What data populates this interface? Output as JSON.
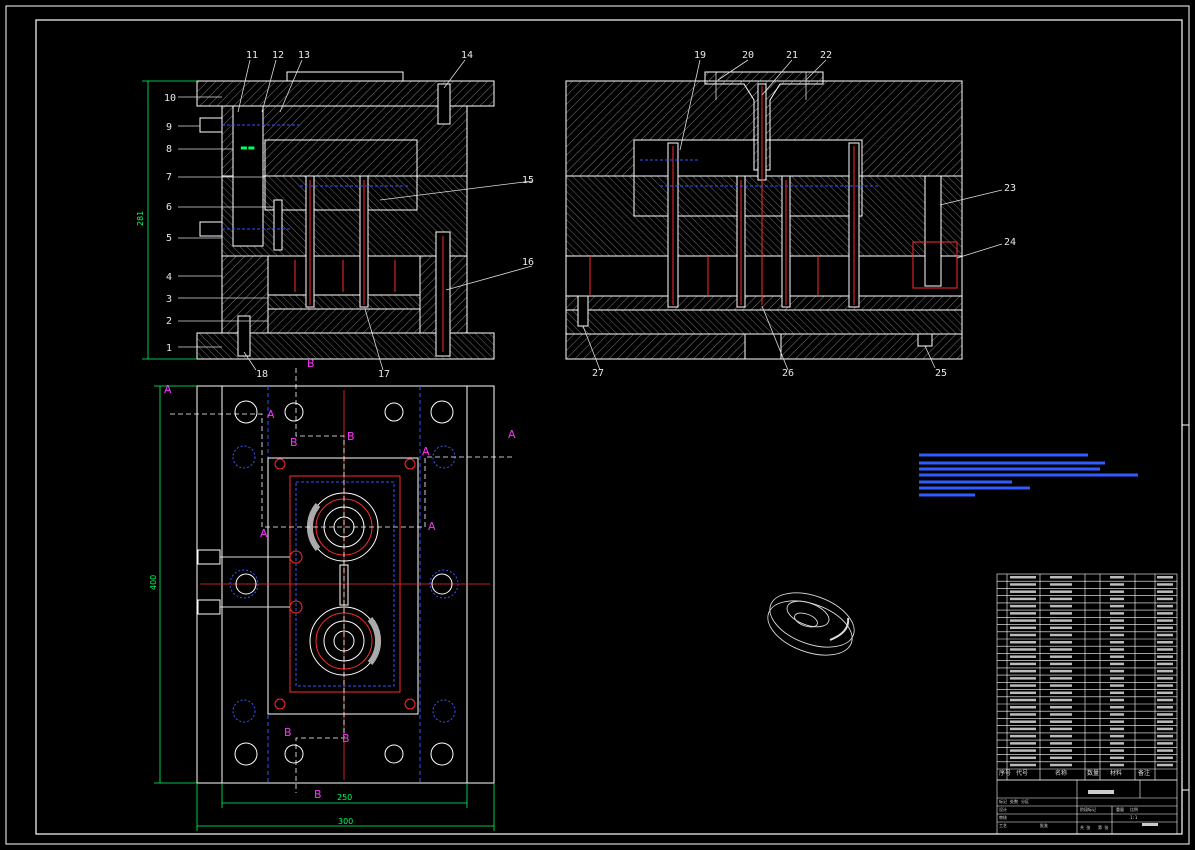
{
  "part_callouts": [
    "1",
    "2",
    "3",
    "4",
    "5",
    "6",
    "7",
    "8",
    "9",
    "10",
    "11",
    "12",
    "13",
    "14",
    "15",
    "16",
    "17",
    "18",
    "19",
    "20",
    "21",
    "22",
    "23",
    "24",
    "25",
    "26",
    "27"
  ],
  "section_marks": {
    "a": "A",
    "b": "B"
  },
  "dimensions": {
    "height_front": "281",
    "height_plan": "400",
    "width_inner": "250",
    "width_outer": "300"
  },
  "colors": {
    "background": "#000000",
    "outline": "#ffffff",
    "hatch": "#bbbbbb",
    "hidden_blue": "#3355ff",
    "center_red": "#ff2a2a",
    "dimension_green": "#00ff66",
    "section_magenta": "#ff33ff"
  },
  "bom": {
    "header": [
      "序号",
      "代号",
      "名称",
      "数量",
      "材料",
      "备注"
    ],
    "row_count": 27
  },
  "title_block": {
    "labels": [
      "标记",
      "处数",
      "分区",
      "设计",
      "审核",
      "工艺",
      "批准",
      "阶段标记",
      "重量",
      "比例",
      "共 张",
      "第 张"
    ],
    "scale": "1:1"
  }
}
